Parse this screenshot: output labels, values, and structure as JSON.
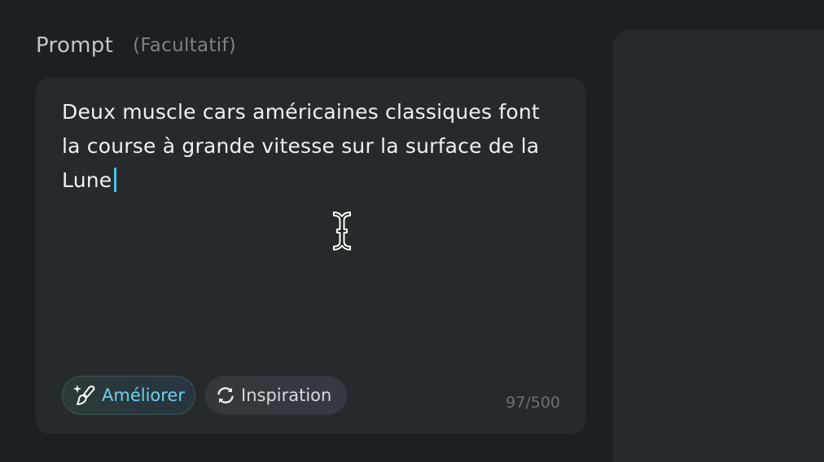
{
  "prompt_section": {
    "label": "Prompt",
    "optional_label": "(Facultatif)",
    "text": "Deux muscle cars américaines classiques font la course à grande vitesse sur la surface de la Lune",
    "char_count": "97/500"
  },
  "actions": {
    "ameliorer_label": "Améliorer",
    "inspiration_label": "Inspiration"
  },
  "colors": {
    "background": "#1d2022",
    "card": "#262a2c",
    "accent": "#4fc3e8",
    "text": "#eef0f1"
  },
  "icons": {
    "ameliorer": "magic-brush-icon",
    "inspiration": "refresh-icon",
    "cursor": "text-cursor-icon"
  }
}
